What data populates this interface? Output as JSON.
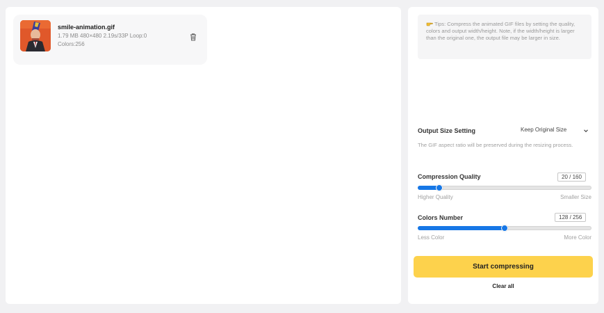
{
  "file": {
    "name": "smile-animation.gif",
    "meta": "1.79 MB 480×480 2.19s/33P Loop:0",
    "colors": "Colors:256"
  },
  "tips": {
    "text": "Tips: Compress the animated GIF files by setting the quality, colors and output width/height. Note, if the width/height is larger than the original one, the output file may be larger in size."
  },
  "output_size": {
    "label": "Output Size Setting",
    "selected": "Keep Original Size",
    "note": "The GIF aspect ratio will be preserved during the resizing process."
  },
  "compression": {
    "label": "Compression Quality",
    "value_text": "20 / 160",
    "value": 20,
    "max": 160,
    "min_label": "Higher Quality",
    "max_label": "Smaller Size"
  },
  "colors_number": {
    "label": "Colors Number",
    "value_text": "128 / 256",
    "value": 128,
    "max": 256,
    "min_label": "Less Color",
    "max_label": "More Color"
  },
  "actions": {
    "start": "Start compressing",
    "clear": "Clear all"
  },
  "theme": {
    "accent": "#1677e6",
    "button": "#fdd24c"
  }
}
